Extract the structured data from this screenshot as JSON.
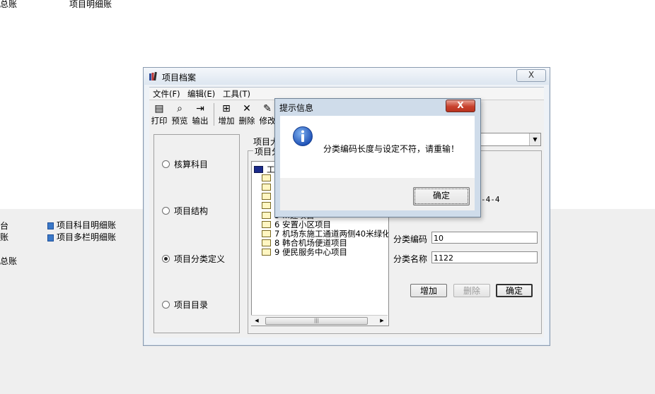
{
  "background": {
    "top_left": "总账",
    "top_middle": "项目明细账",
    "left_items": [
      "台",
      "账",
      "总账"
    ],
    "links": [
      "项目科目明细账",
      "项目多栏明细账"
    ]
  },
  "window": {
    "title": "项目档案",
    "close_glyph": "X",
    "menu": [
      "文件(F)",
      "编辑(E)",
      "工具(T)"
    ],
    "toolbar": [
      {
        "label": "打印",
        "icon": "printer-icon",
        "glyph": "▤"
      },
      {
        "label": "预览",
        "icon": "preview-icon",
        "glyph": "🔍"
      },
      {
        "label": "输出",
        "icon": "export-icon",
        "glyph": "⇥"
      },
      {
        "label": "增加",
        "icon": "add-icon",
        "glyph": "+"
      },
      {
        "label": "删除",
        "icon": "delete-icon",
        "glyph": "✕"
      },
      {
        "label": "修改",
        "icon": "edit-icon",
        "glyph": "✎"
      }
    ],
    "radios": [
      {
        "label": "核算科目",
        "checked": false
      },
      {
        "label": "项目结构",
        "checked": false
      },
      {
        "label": "项目分类定义",
        "checked": true
      },
      {
        "label": "项目目录",
        "checked": false
      }
    ],
    "project_label_partial": "项目大",
    "group_label_partial": "项目分",
    "tree": {
      "root": "工",
      "items": [
        {
          "text": "",
          "partial": true
        },
        {
          "text": "",
          "partial": true
        },
        {
          "text": "",
          "partial": true
        },
        {
          "text": "",
          "partial": true
        },
        {
          "text": "5 ...建项目",
          "partial": true
        },
        {
          "text": "6 安置小区项目"
        },
        {
          "text": "7 机场东施工通道两侧40米绿化I"
        },
        {
          "text": "8 韩合机场便道项目"
        },
        {
          "text": "9 便民服务中心项目"
        }
      ]
    },
    "code_rule_partial": "-4-4",
    "fields": {
      "code_label": "分类编码",
      "code_value": "10",
      "name_label": "分类名称",
      "name_value": "1122"
    },
    "buttons": {
      "add": "增加",
      "delete": "删除",
      "confirm": "确定"
    }
  },
  "dialog": {
    "title": "提示信息",
    "close_glyph": "X",
    "message": "分类编码长度与设定不符，请重输！",
    "ok": "确定"
  }
}
